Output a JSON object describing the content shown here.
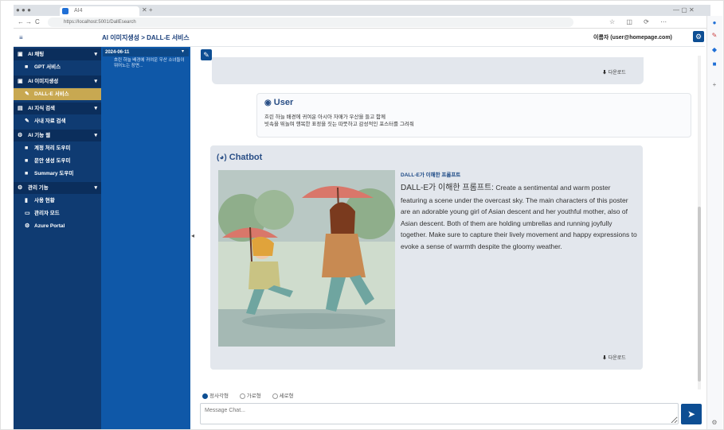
{
  "browser": {
    "tab_title": "AI4",
    "url": "https://localhost:5001/DallEsearch",
    "back": "←",
    "forward": "→",
    "reload": "C",
    "home": "⌂"
  },
  "header": {
    "breadcrumb": "AI 이미지생성 > DALL-E 서비스",
    "user_label": "이름자 (user@homepage.com)",
    "gear": "⚙"
  },
  "sidebar": {
    "items": [
      {
        "label": "AI 채팅",
        "type": "group",
        "icon": "▣"
      },
      {
        "label": "GPT 서비스",
        "type": "sub",
        "icon": "■"
      },
      {
        "label": "AI 이미지생성",
        "type": "group",
        "icon": "▣"
      },
      {
        "label": "DALL-E 서비스",
        "type": "active",
        "icon": "✎"
      },
      {
        "label": "AI 지식 검색",
        "type": "group",
        "icon": "▤"
      },
      {
        "label": "사내 자료 검색",
        "type": "sub",
        "icon": "✎"
      },
      {
        "label": "AI 기능 웹",
        "type": "group",
        "icon": "⚙"
      },
      {
        "label": "계정 처리 도우미",
        "type": "sub",
        "icon": "■"
      },
      {
        "label": "문안 생성 도우미",
        "type": "sub",
        "icon": "■"
      },
      {
        "label": "Summary 도우미",
        "type": "sub",
        "icon": "■"
      },
      {
        "label": "관리 기능",
        "type": "group",
        "icon": "⚙"
      },
      {
        "label": "사용 현황",
        "type": "sub",
        "icon": "▮"
      },
      {
        "label": "관리자 모드",
        "type": "sub",
        "icon": "▭"
      },
      {
        "label": "Azure Portal",
        "type": "sub",
        "icon": "⚙"
      }
    ]
  },
  "history": {
    "date": "2024-06-11",
    "item": "흐린 하늘 배경에 귀여운 우산 소녀들이 뛰어노는 장면..."
  },
  "chat": {
    "download_label": "다운로드",
    "user": {
      "name": "User",
      "line1": "흐린 하늘 배경에 귀여운 아시아 자매가 우산을 들고 함께",
      "line2": "빗속을 뛰놀며 행복한 표정을 짓는 따뜻하고 감성적인 포스터를 그려줘"
    },
    "bot": {
      "name": "Chatbot",
      "request_label": "DALL-E가 이해한 프롬프트",
      "prefix": "DALL-E가 이해한 프롬프트:",
      "text": "Create a sentimental and warm poster featuring a scene under the overcast sky. The main characters of this poster are an adorable young girl of Asian descent and her youthful mother, also of Asian descent. Both of them are holding umbrellas and running joyfully together. Make sure to capture their lively movement and happy expressions to evoke a sense of warmth despite the gloomy weather."
    }
  },
  "composer": {
    "options": [
      "정사각형",
      "가로형",
      "세로형"
    ],
    "selected_index": 0,
    "placeholder": "Message Chat...",
    "send": "➤"
  },
  "colors": {
    "sidebar": "#0f3b72",
    "history": "#0f58a8",
    "accent": "#0d4e93",
    "active": "#c8a851",
    "bubble": "#e3e7ed"
  }
}
